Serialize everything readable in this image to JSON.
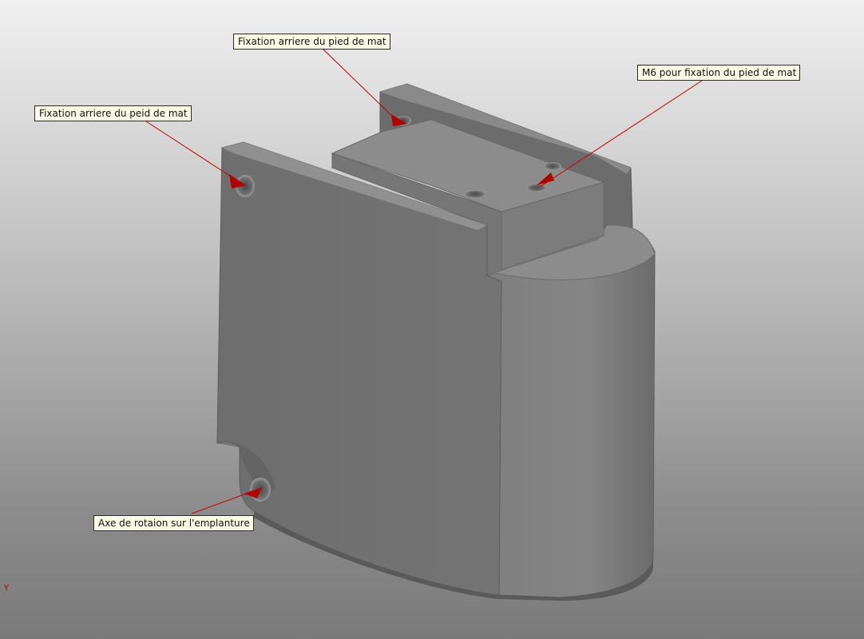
{
  "annotations": [
    {
      "id": "rear-fix-top",
      "text": "Fixation arriere du pied de mat"
    },
    {
      "id": "m6-fix",
      "text": "M6 pour fixation du pied de mat"
    },
    {
      "id": "rear-fix-left",
      "text": "Fixation arriere du peid de mat"
    },
    {
      "id": "rotation-axis",
      "text": "Axe de rotaion sur l'emplanture"
    }
  ],
  "axis": {
    "y_label": "Y"
  },
  "colors": {
    "part_face_front": "#727272",
    "part_face_right": "#7a7a7a",
    "part_face_top": "#8a8a8a",
    "leader_line": "#c40000",
    "callout_bg": "#fbfbe6"
  }
}
